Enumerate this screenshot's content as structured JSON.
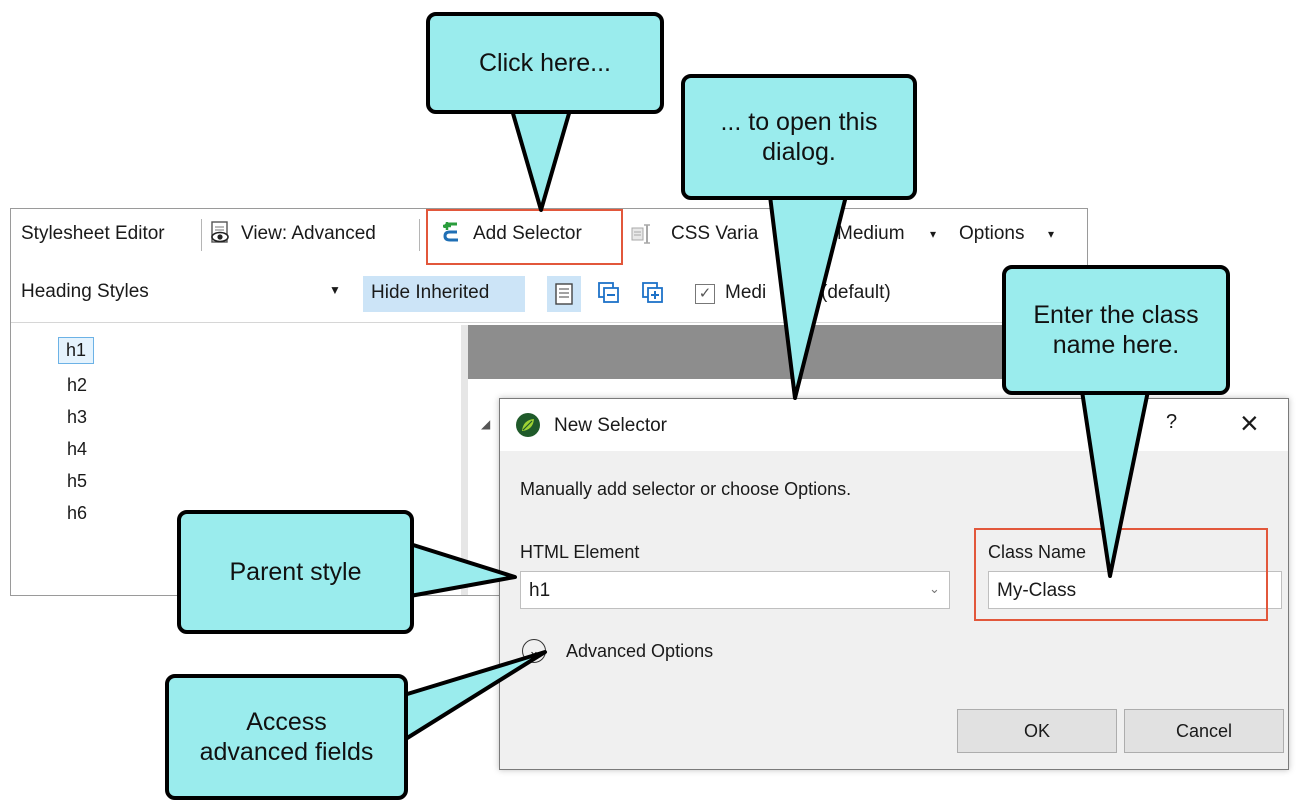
{
  "toolbar": {
    "title": "Stylesheet Editor",
    "view_label": "View: Advanced",
    "add_selector_label": "Add Selector",
    "css_variables_label": "CSS Varia",
    "medium_label": "Medium",
    "options_label": "Options"
  },
  "toolbar2": {
    "style_group_value": "Heading Styles",
    "hide_inherited_label": "Hide Inherited",
    "medium_check_label": "Medi",
    "medium_default_label": "(default)"
  },
  "tree": {
    "items": [
      "h1",
      "h2",
      "h3",
      "h4",
      "h5",
      "h6"
    ]
  },
  "dialog": {
    "title": "New Selector",
    "help_label": "?",
    "close_label": "×",
    "instruction": "Manually add selector or choose Options.",
    "html_element_label": "HTML Element",
    "html_element_value": "h1",
    "class_name_label": "Class Name",
    "class_name_value": "My-Class",
    "advanced_options_label": "Advanced Options",
    "ok_label": "OK",
    "cancel_label": "Cancel"
  },
  "callouts": {
    "click_here": "Click here...",
    "open_dialog_line1": "... to open this",
    "open_dialog_line2": "dialog.",
    "enter_class_line1": "Enter the class",
    "enter_class_line2": "name here.",
    "parent_style": "Parent style",
    "access_line1": "Access",
    "access_line2": "advanced fields"
  },
  "colors": {
    "callout_fill": "#9aeced",
    "highlight_red": "#e2573b",
    "selection_blue": "#e5f3fd"
  }
}
